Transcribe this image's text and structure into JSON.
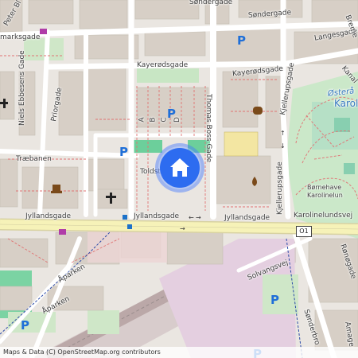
{
  "map": {
    "colors": {
      "land": "#eae6e1",
      "building": "#d9d2c9",
      "major_road": "#f4f0b0",
      "park": "#c8e8c8",
      "rail": "#c9b9b9",
      "accent": "#2d6cf0"
    },
    "streets": {
      "jyllandsgade_1": "Jyllandsgade",
      "jyllandsgade_2": "Jyllandsgade",
      "jyllandsgade_3": "Jyllandsgade",
      "karolinelundsvej": "Karolinelundsvej",
      "kayerodsgade_1": "Kayerødsgade",
      "kayerodsgade_2": "Kayerødsgade",
      "thomas_boss_gade": "Thomas Boss Gade",
      "kjellerupsgade": "Kjellerupsgade",
      "kjellerupsgade_2": "Kjellerupsgade",
      "sondergade_1": "Søndergade",
      "sondergade_2": "Søndergade",
      "langesgade": "Langesgade",
      "niels_ebbesens_gade": "Niels Ebbesens Gade",
      "priorgade": "Priorgade",
      "traebanen": "Træbanen",
      "toldst": "Toldst",
      "aaparken_1": "Åparken",
      "aaparken_2": "Åparken",
      "solvangsvej": "Solvangsvej",
      "ranogade": "Rønøgade",
      "sonderbro": "Sønderbro",
      "marksgade": "marksgade",
      "peter_b": "Peter Bl",
      "kanal": "Kanal",
      "bremer": "Breme",
      "amager": "Amage",
      "a": "A",
      "b": "B",
      "c": "C",
      "d": "D"
    },
    "places": {
      "ostera": "Østerå",
      "karol": "Karol",
      "bornehave": "Børnehave",
      "karolinelund": "Karolinelun"
    },
    "route_label": "O1",
    "parking_symbol": "P",
    "current_location_icon": "home-icon",
    "attribution": "Maps & Data (C) OpenStreetMap.org contributors"
  }
}
